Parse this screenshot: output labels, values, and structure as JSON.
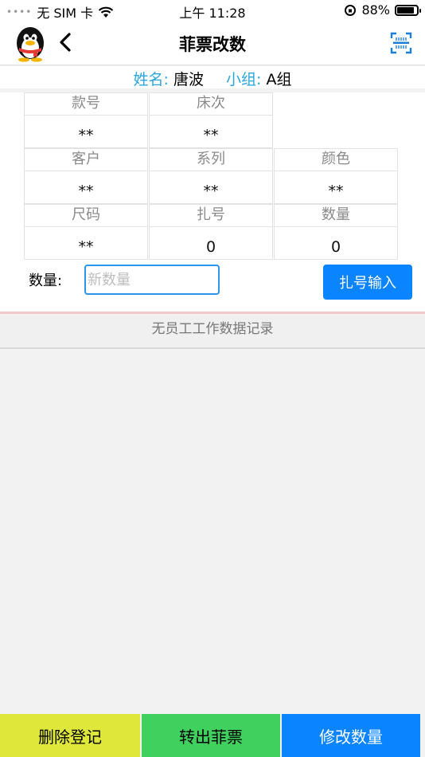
{
  "status": {
    "carrier": "无 SIM 卡",
    "time": "上午 11:28",
    "battery": "88%",
    "battery_level": 0.88
  },
  "nav": {
    "title": "菲票改数",
    "icons": [
      "qq-penguin-avatar",
      "back-chevron-icon",
      "barcode-scan-icon"
    ]
  },
  "info": {
    "name_label": "姓名:",
    "name_value": "唐波",
    "group_label": "小组:",
    "group_value": "A组"
  },
  "grid": [
    {
      "label": "款号",
      "value": "**"
    },
    {
      "label": "床次",
      "value": "**"
    },
    {
      "label": "客户",
      "value": "**"
    },
    {
      "label": "系列",
      "value": "**"
    },
    {
      "label": "颜色",
      "value": "**"
    },
    {
      "label": "尺码",
      "value": "**"
    },
    {
      "label": "扎号",
      "value": "0"
    },
    {
      "label": "数量",
      "value": "0"
    }
  ],
  "quantity": {
    "label": "数量:",
    "placeholder": "新数量",
    "value": ""
  },
  "bundle_button": "扎号输入",
  "empty_message": "无员工工作数据记录",
  "actions": {
    "delete": "删除登记",
    "transfer": "转出菲票",
    "modify": "修改数量"
  },
  "colors": {
    "accent_blue": "#0a84ff",
    "label_blue": "#2aa6de",
    "yellow": "#dfe83a",
    "green": "#3fd05e"
  }
}
